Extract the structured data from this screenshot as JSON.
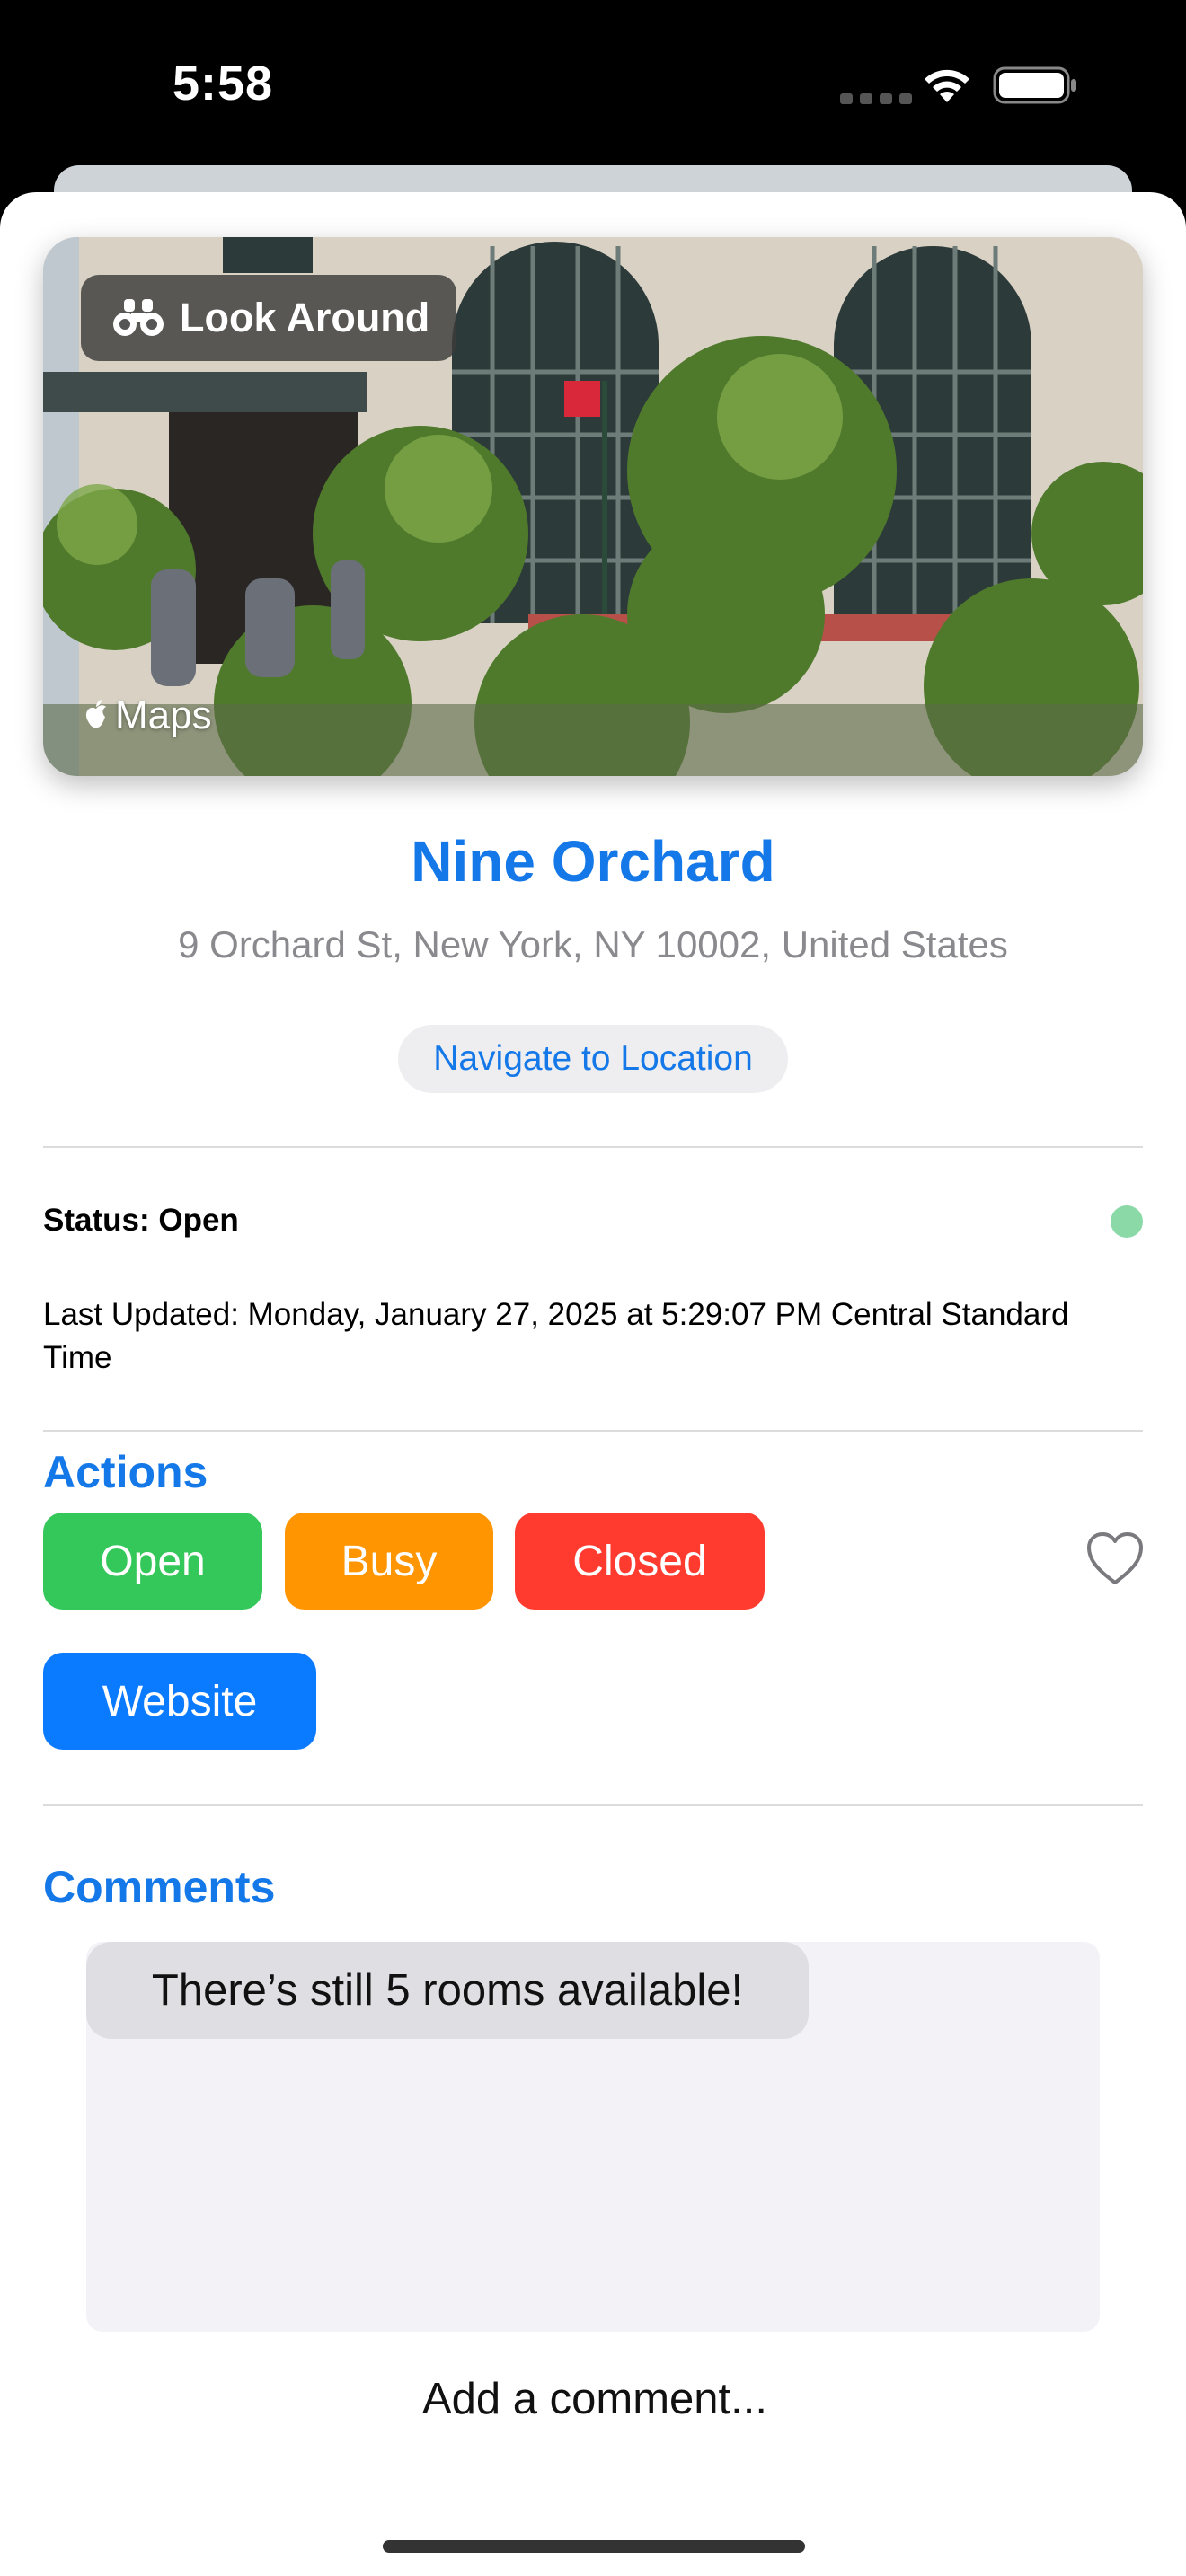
{
  "status_bar": {
    "time": "5:58"
  },
  "look_around": {
    "label": "Look Around",
    "brand": "Maps"
  },
  "place": {
    "name": "Nine Orchard",
    "address": "9 Orchard St, New York, NY 10002, United States",
    "navigate_label": "Navigate to Location"
  },
  "status": {
    "label": "Status: Open",
    "indicator_color": "#8ad9a6",
    "last_updated": "Last Updated: Monday, January 27, 2025 at 5:29:07 PM Central Standard Time"
  },
  "actions": {
    "title": "Actions",
    "open_label": "Open",
    "busy_label": "Busy",
    "closed_label": "Closed",
    "website_label": "Website",
    "colors": {
      "open": "#34c759",
      "busy": "#ff9500",
      "closed": "#ff3b30",
      "website": "#0a7aff"
    }
  },
  "comments": {
    "title": "Comments",
    "items": [
      {
        "text": "There’s still 5 rooms available!"
      }
    ],
    "input_placeholder": "Add a comment..."
  },
  "accent_color": "#1478e8"
}
